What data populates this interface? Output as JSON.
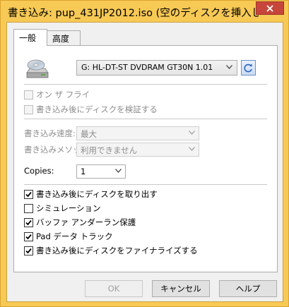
{
  "window": {
    "title": "書き込み: pup_431JP2012.iso (空のディスクを挿入し..."
  },
  "tabs": [
    {
      "label": "一般"
    },
    {
      "label": "高度"
    }
  ],
  "drive": {
    "selected": "G: HL-DT-ST DVDRAM GT30N 1.01"
  },
  "options": {
    "on_the_fly": {
      "label": "オン ザ フライ",
      "checked": false,
      "enabled": false
    },
    "verify": {
      "label": "書き込み後にディスクを検証する",
      "checked": false,
      "enabled": false
    }
  },
  "fields": {
    "speed": {
      "label": "書き込み速度:",
      "value": "最大"
    },
    "method": {
      "label": "書き込みメソッド:",
      "value": "利用できません"
    },
    "copies": {
      "label": "Copies:",
      "value": "1"
    }
  },
  "checkboxes": [
    {
      "label": "書き込み後にディスクを取り出す",
      "checked": true
    },
    {
      "label": "シミュレーション",
      "checked": false
    },
    {
      "label": "バッファ アンダーラン保護",
      "checked": true
    },
    {
      "label": "Pad データ トラック",
      "checked": true
    },
    {
      "label": "書き込み後にディスクをファイナライズする",
      "checked": true
    }
  ],
  "buttons": {
    "ok": "OK",
    "cancel": "キャンセル",
    "help": "ヘルプ"
  },
  "colors": {
    "titlebar": "#f7c955",
    "close": "#c7463c"
  }
}
